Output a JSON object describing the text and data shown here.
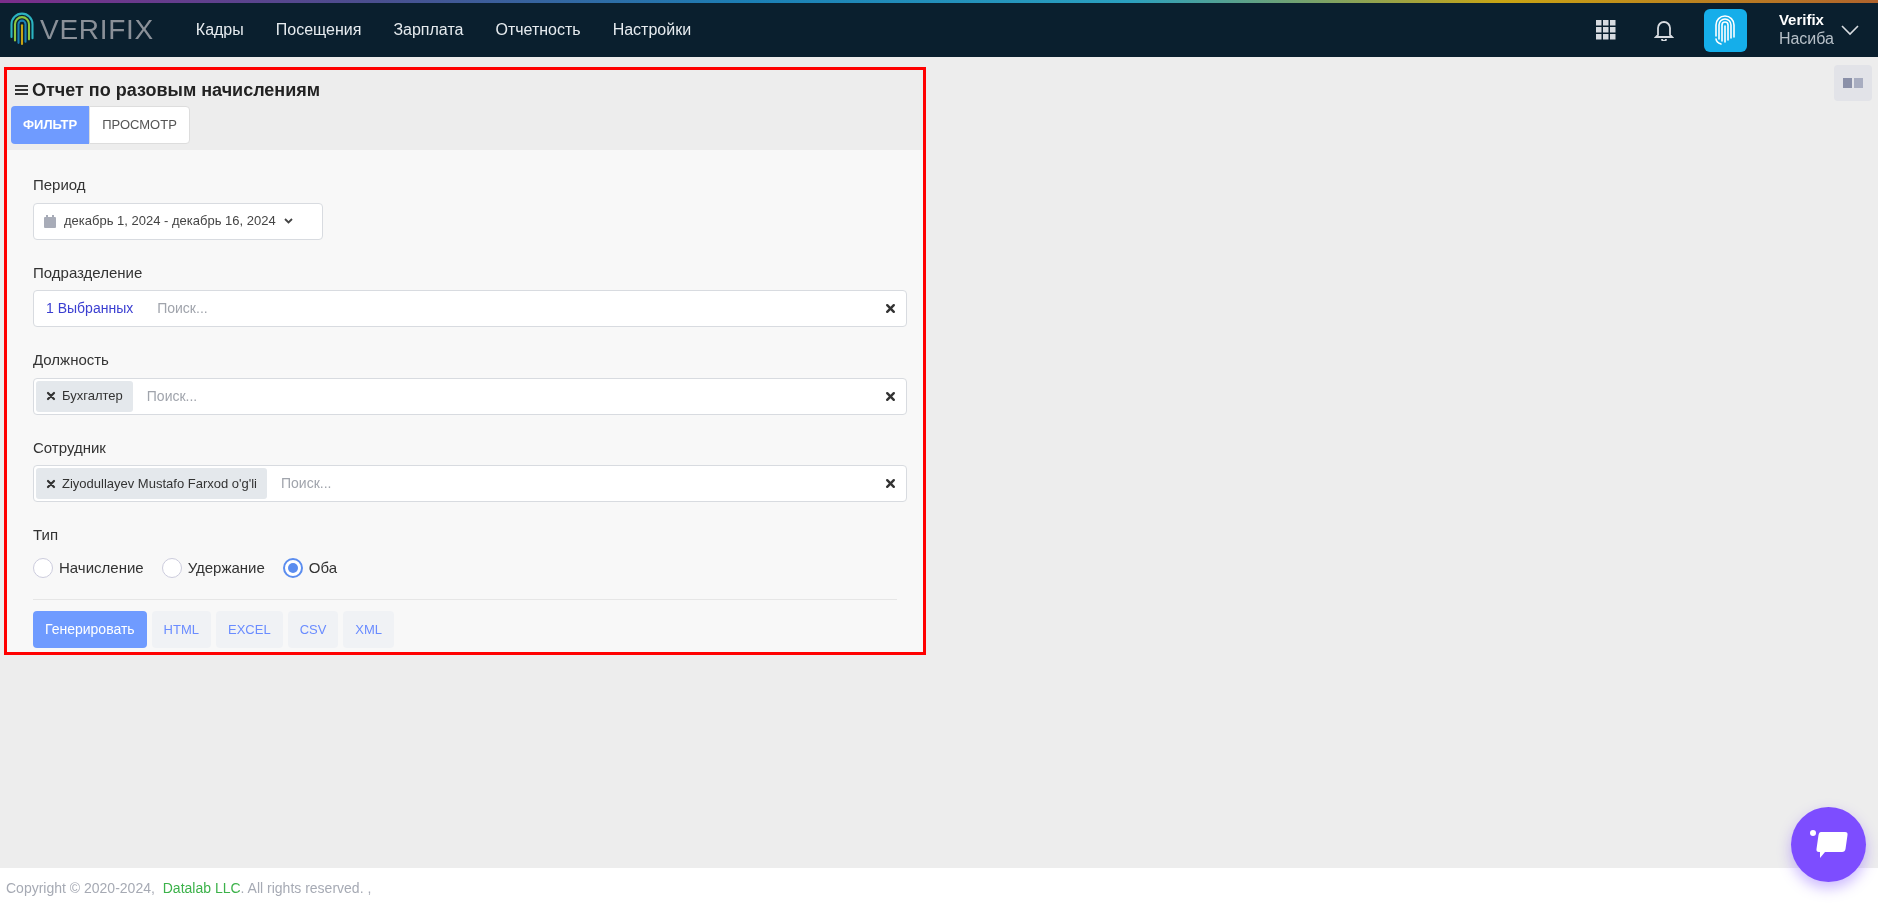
{
  "nav": {
    "logo": "VERIFIX",
    "menu": [
      "Кадры",
      "Посещения",
      "Зарплата",
      "Отчетность",
      "Настройки"
    ],
    "user": {
      "company": "Verifix",
      "name": "Насиба"
    }
  },
  "report": {
    "title": "Отчет по разовым начислениям",
    "tabs": [
      {
        "label": "ФИЛЬТР",
        "selected": true
      },
      {
        "label": "ПРОСМОТР",
        "selected": false
      }
    ],
    "period": {
      "label": "Период",
      "value": "декабрь 1, 2024 - декабрь 16, 2024"
    },
    "filters": [
      {
        "label": "Подразделение",
        "summary": "1 Выбранных",
        "placeholder": "Поиск..."
      },
      {
        "label": "Должность",
        "chips": [
          "Бухгалтер"
        ],
        "placeholder": "Поиск..."
      },
      {
        "label": "Сотрудник",
        "chips": [
          "Ziyodullayev Mustafo Farxod o'g'li"
        ],
        "placeholder": "Поиск..."
      }
    ],
    "type": {
      "label": "Тип",
      "options": [
        {
          "label": "Начисление",
          "selected": false
        },
        {
          "label": "Удержание",
          "selected": false
        },
        {
          "label": "Оба",
          "selected": true
        }
      ]
    },
    "buttons": [
      {
        "label": "Генерировать",
        "kind": "primary"
      },
      {
        "label": "HTML",
        "kind": "export"
      },
      {
        "label": "EXCEL",
        "kind": "export"
      },
      {
        "label": "CSV",
        "kind": "export"
      },
      {
        "label": "XML",
        "kind": "export"
      }
    ]
  },
  "footer": {
    "copyright": "Copyright © 2020-2024, ",
    "company": "Datalab LLC",
    "rest": ". All rights reserved. ,"
  }
}
